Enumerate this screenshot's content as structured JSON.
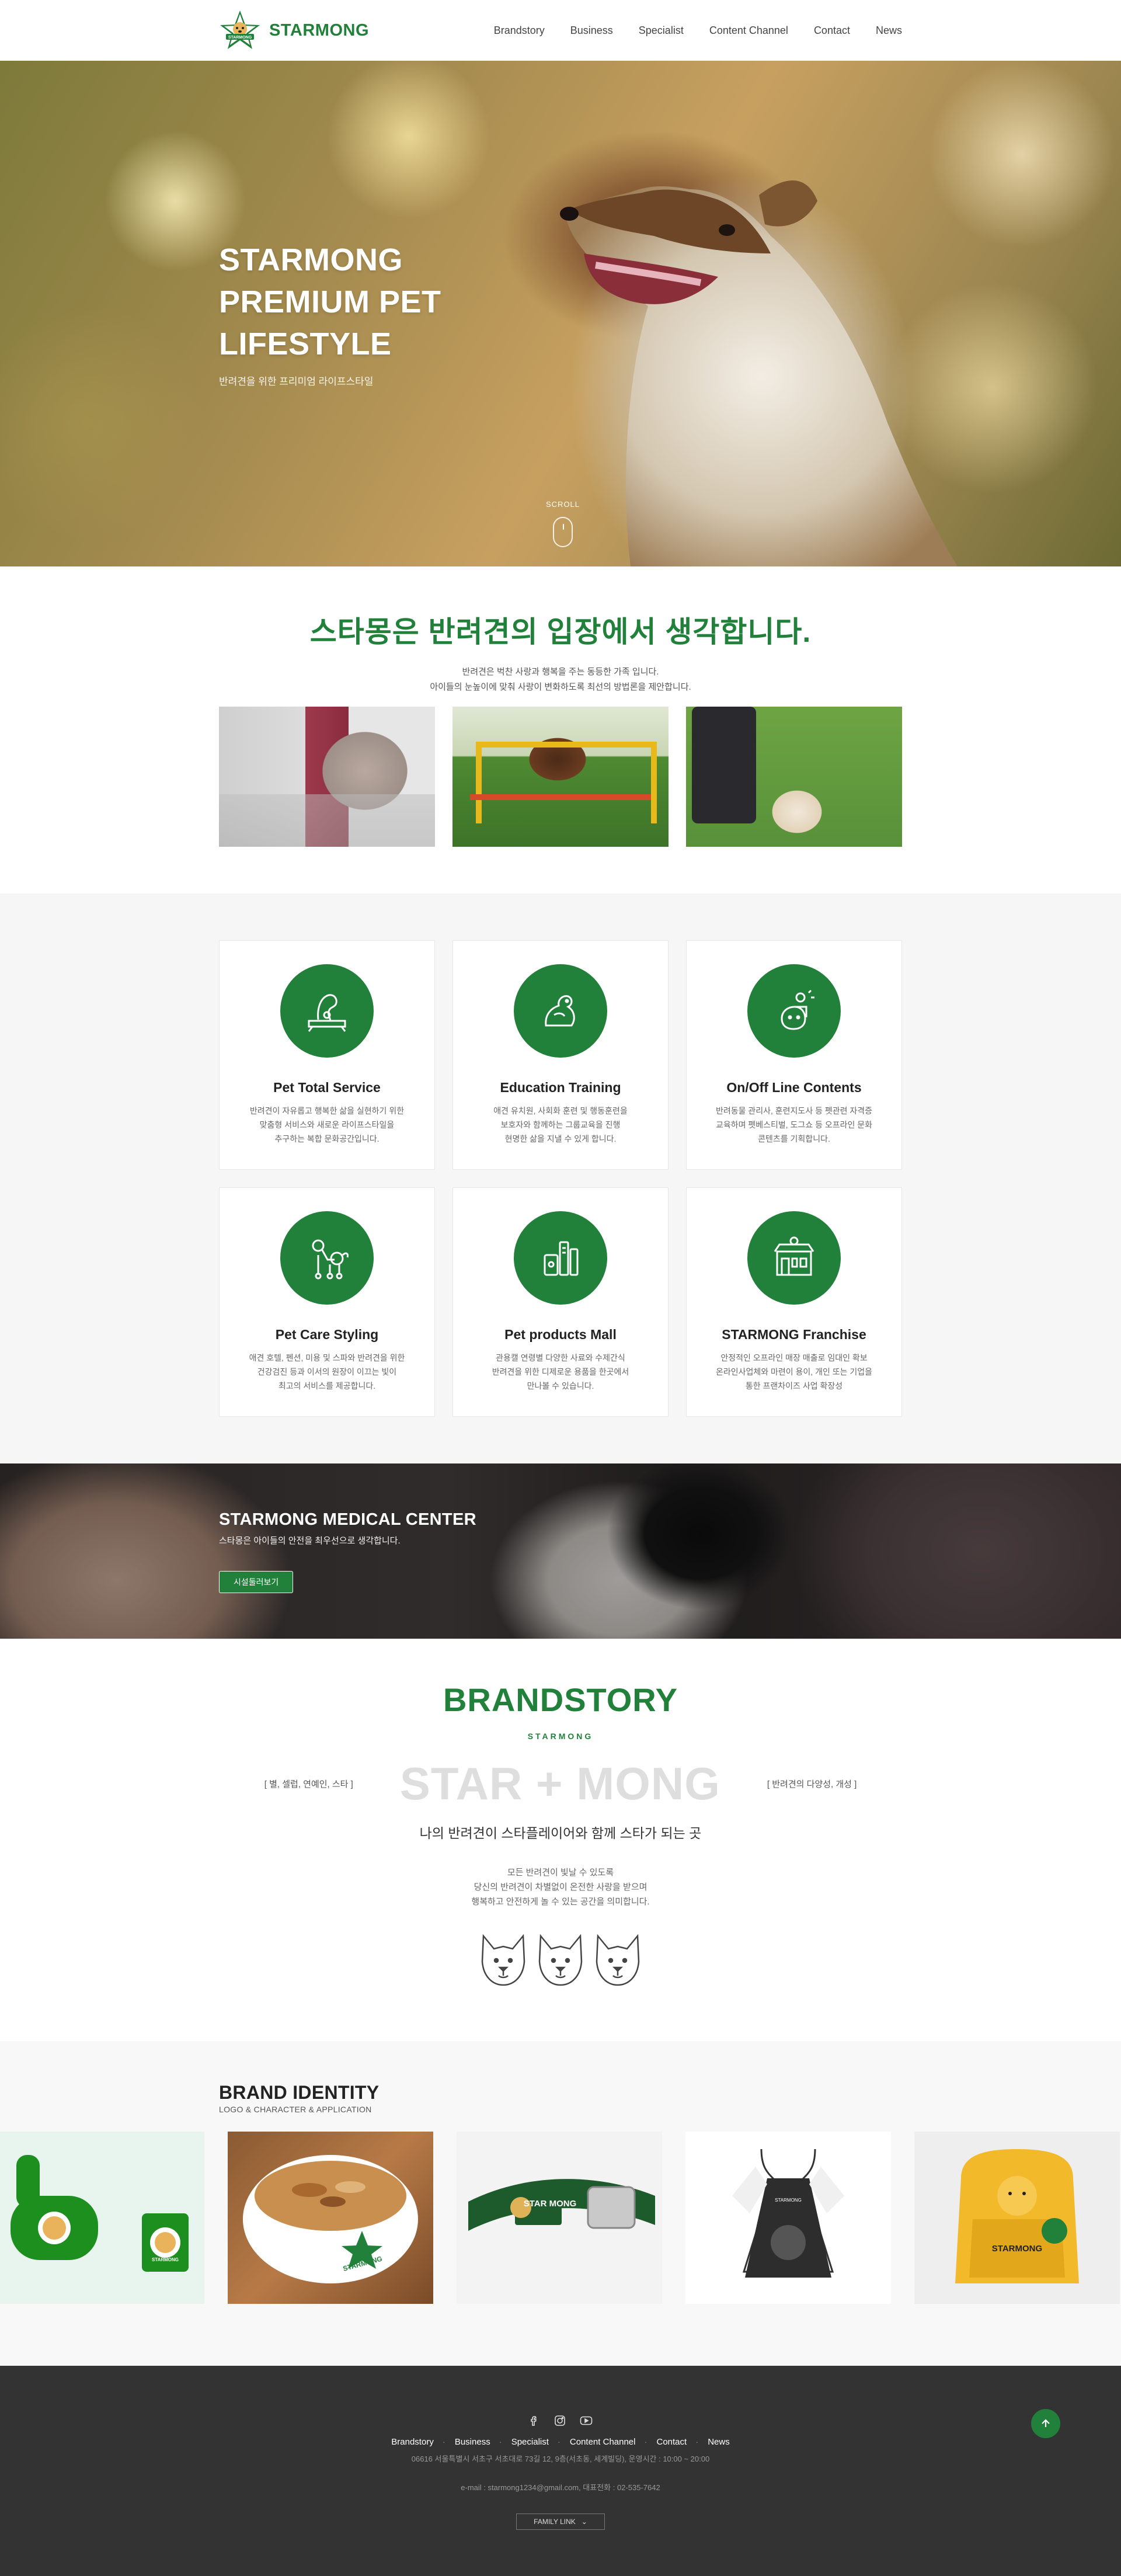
{
  "header": {
    "logo_text": "STARMONG",
    "nav": [
      "Brandstory",
      "Business",
      "Specialist",
      "Content Channel",
      "Contact",
      "News"
    ]
  },
  "hero": {
    "title": "STARMONG\nPREMIUM PET\nLIFESTYLE",
    "subtitle": "반려견을 위한 프리미엄 라이프스타일",
    "scroll_label": "SCROLL"
  },
  "intro": {
    "heading": "스타몽은 반려견의 입장에서 생각합니다.",
    "text": "반려견은 벅찬 사랑과 행복을 주는 동등한 가족 입니다.\n아이들의 눈높이에 맞춰 사랑이 변화하도록 최선의 방법론을 제안합니다."
  },
  "services": [
    {
      "title": "Pet Total Service",
      "desc": "반려견이 자유롭고 행복한 삶을 실현하기 위한\n맞춤형 서비스와 새로운 라이프스타일을\n추구하는 복합 문화공간입니다.",
      "icon": "dog-certificate-icon"
    },
    {
      "title": "Education Training",
      "desc": "애견 유치원, 사회화 훈련 및 행동훈련을\n보호자와 함께하는 그룹교육을 진행\n현명한 삶을 지낼 수 있게 합니다.",
      "icon": "dog-training-icon"
    },
    {
      "title": "On/Off Line Contents",
      "desc": "반려동물 관리사, 훈련지도사 등 펫관련 자격증\n교육하며 펫베스티벌, 도그쇼 등 오프라인 문화\n콘텐츠를 기획합니다.",
      "icon": "dog-content-icon"
    },
    {
      "title": "Pet Care Styling",
      "desc": "애견 호텔, 펜션, 미용 및 스파와 반려견을 위한\n건강검진 등과 이서의 원장이 이끄는 빛이\n최고의 서비스를 제공합니다.",
      "icon": "poodle-icon"
    },
    {
      "title": "Pet products Mall",
      "desc": "관용캘 연령별 다양한 사료와 수제간식\n반려견을 위한 디제로운 용품을 한곳에서\n만나볼 수 있습니다.",
      "icon": "pet-products-icon"
    },
    {
      "title": "STARMONG Franchise",
      "desc": "안정적인 오프라인 매장 매출로 임대인 확보\n온라인사업체와 마련이 용이, 개인 또는 기업을\n통한 프랜차이즈 사업 확장성",
      "icon": "franchise-store-icon"
    }
  ],
  "medical": {
    "title": "STARMONG MEDICAL CENTER",
    "subtitle": "스타몽은 아이들의 안전을 최우선으로 생각합니다.",
    "button": "시설둘러보기"
  },
  "brandstory": {
    "title": "BRANDSTORY",
    "subtitle": "STARMONG",
    "left": "[ 별, 셀럽, 연예인, 스타 ]",
    "big": "STAR + MONG",
    "right": "[ 반려견의 다양성, 개성 ]",
    "line": "나의 반려견이 스타플레이어와 함께 스타가 되는 곳",
    "desc": "모든 반려견이 빛날 수 있도록\n당신의 반려견이 차별없이 온전한 사랑을 받으며\n행복하고 안전하게 놀 수 있는 공간을 의미합니다."
  },
  "identity": {
    "title": "BRAND IDENTITY",
    "subtitle": "LOGO & CHARACTER & APPLICATION",
    "items": [
      {
        "type": "poop-bag-holder",
        "label": "STARMONG"
      },
      {
        "type": "dog-food-bowl",
        "label": "STARMONG"
      },
      {
        "type": "dog-collar",
        "label": "STAR MONG"
      },
      {
        "type": "apron",
        "label": "STARMONG"
      },
      {
        "type": "backpack",
        "label": "STARMONG"
      }
    ]
  },
  "footer": {
    "nav": [
      "Brandstory",
      "Business",
      "Specialist",
      "Content Channel",
      "Contact",
      "News"
    ],
    "address": "06616 서울특별시 서초구 서초대로 73길 12, 9층(서초동, 세계빌딩), 운영시간 : 10:00 ~ 20:00",
    "contact": "e-mail : starmong1234@gmail.com, 대표전화 : 02-535-7642",
    "family_link": "FAMILY LINK",
    "family_arrow": "⌄"
  },
  "colors": {
    "brand": "#21803a",
    "footer": "#333333"
  }
}
